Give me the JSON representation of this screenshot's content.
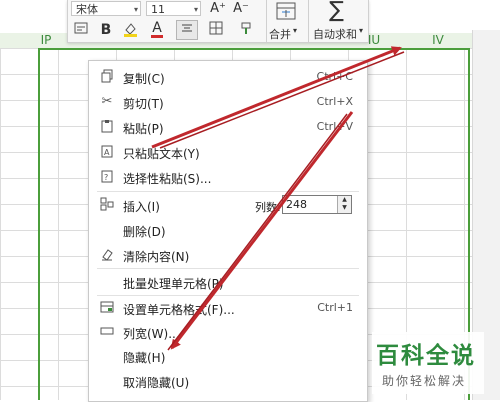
{
  "ribbon": {
    "font_name": "宋体",
    "font_size": "11",
    "merge_label": "合并",
    "merge_arrow": "▾",
    "sum_label": "自动求和",
    "sum_arrow": "▾",
    "font_grow_glyph": "A⁺",
    "font_shrink_glyph": "A⁻",
    "bold_glyph": "B",
    "font_color_glyph": "A",
    "sum_glyph": "∑"
  },
  "columns": [
    "IP",
    "IU",
    "IV"
  ],
  "context_menu": {
    "items": [
      {
        "label": "复制(C)",
        "shortcut": "Ctrl+C",
        "icon": "copy-icon"
      },
      {
        "label": "剪切(T)",
        "shortcut": "Ctrl+X",
        "icon": "cut-icon"
      },
      {
        "label": "粘贴(P)",
        "shortcut": "Ctrl+V",
        "icon": "paste-icon"
      },
      {
        "label": "只粘贴文本(Y)",
        "shortcut": "",
        "icon": "paste-text-icon"
      },
      {
        "label": "选择性粘贴(S)...",
        "shortcut": "",
        "icon": "paste-special-icon"
      },
      {
        "label": "插入(I)",
        "shortcut": "",
        "icon": "insert-icon"
      },
      {
        "label": "删除(D)",
        "shortcut": "",
        "icon": ""
      },
      {
        "label": "清除内容(N)",
        "shortcut": "",
        "icon": "eraser-icon"
      },
      {
        "label": "批量处理单元格(P)",
        "shortcut": "",
        "icon": ""
      },
      {
        "label": "设置单元格格式(F)...",
        "shortcut": "Ctrl+1",
        "icon": "format-cells-icon"
      },
      {
        "label": "列宽(W)...",
        "shortcut": "",
        "icon": "column-width-icon"
      },
      {
        "label": "隐藏(H)",
        "shortcut": "",
        "icon": ""
      },
      {
        "label": "取消隐藏(U)",
        "shortcut": "",
        "icon": ""
      }
    ],
    "insert_count_label": "列数:",
    "insert_count_value": "248"
  },
  "watermark": {
    "title": "百科全说",
    "subtitle": "助你轻松解决"
  },
  "colors": {
    "annotation_arrow": "#c0282d",
    "column_header_text": "#3c8a3c",
    "watermark_green": "#2e8b3e"
  }
}
